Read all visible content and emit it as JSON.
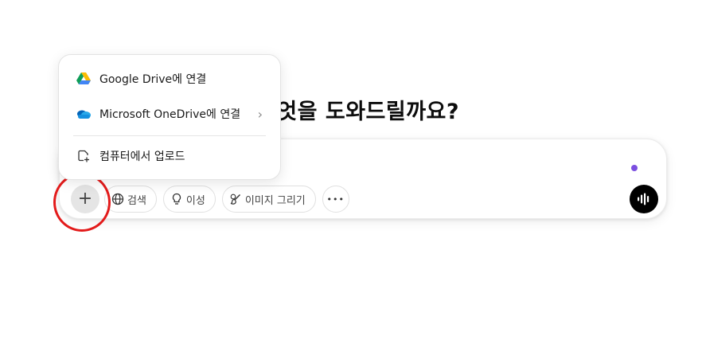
{
  "main": {
    "headline": "무엇을 도와드릴까요?"
  },
  "composer": {
    "plus_label": "+",
    "tools": [
      {
        "label": "검색"
      },
      {
        "label": "이성"
      },
      {
        "label": "이미지 그리기"
      }
    ],
    "more_label": "•••",
    "accent_dot_color": "#7b4fe0",
    "highlight_color": "#e31b1b"
  },
  "attach_menu": {
    "items": [
      {
        "label": "Google Drive에 연결",
        "icon": "google-drive-icon"
      },
      {
        "label": "Microsoft OneDrive에 연결",
        "icon": "onedrive-icon",
        "chevron": "›"
      },
      {
        "label": "컴퓨터에서 업로드",
        "icon": "upload-from-computer-icon"
      }
    ]
  }
}
